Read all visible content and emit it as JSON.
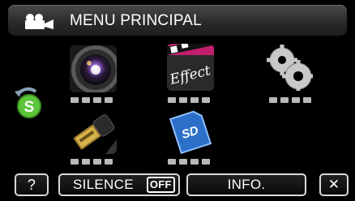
{
  "header": {
    "title": "MENU PRINCIPAL",
    "icon": "movie-camera-icon"
  },
  "menu": {
    "tiles": [
      {
        "name": "lens-icon",
        "label": ""
      },
      {
        "name": "effect-icon",
        "label": "Effect"
      },
      {
        "name": "gears-icon",
        "label": ""
      },
      {
        "name": "hdmi-cable-icon",
        "label": ""
      },
      {
        "name": "sd-card-icon",
        "label": "SD"
      }
    ],
    "side_icon": {
      "name": "sync-s-icon",
      "label": "S"
    }
  },
  "toolbar": {
    "help_label": "?",
    "silence_label": "SILENCE",
    "silence_state": "OFF",
    "info_label": "INFO.",
    "close_label": "✕"
  },
  "colors": {
    "title_bar": "#2f2f2f",
    "button_border": "#d8d8d8",
    "sync_green": "#5cc63a",
    "effect_magenta": "#c2206f",
    "sd_blue": "#2b6fc9"
  }
}
